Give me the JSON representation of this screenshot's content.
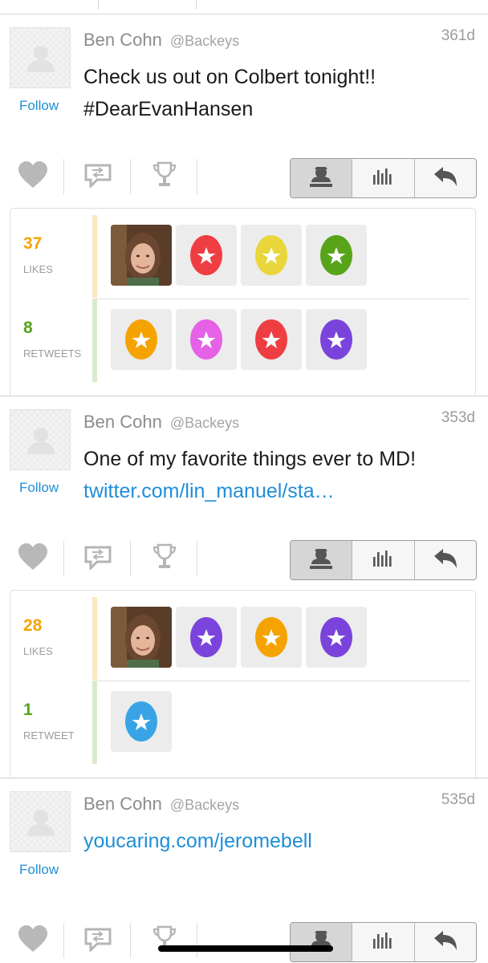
{
  "tweets": [
    {
      "author": "Ben Cohn",
      "handle": "@Backeys",
      "time": "361d",
      "follow_label": "Follow",
      "lines": [
        "Check us out on Colbert tonight!!",
        "#DearEvanHansen"
      ],
      "link_lines": [],
      "stats": {
        "likes_count": "37",
        "likes_label": "LIKES",
        "retweets_count": "8",
        "retweets_label": "RETWEETS",
        "likers": [
          "photo",
          "red",
          "yellow",
          "green"
        ],
        "retweeters": [
          "orange",
          "pink",
          "red",
          "purple"
        ]
      }
    },
    {
      "author": "Ben Cohn",
      "handle": "@Backeys",
      "time": "353d",
      "follow_label": "Follow",
      "lines": [
        "One of my favorite things ever to MD!",
        "twitter.com/lin_manuel/sta…"
      ],
      "link_lines": [
        1
      ],
      "stats": {
        "likes_count": "28",
        "likes_label": "LIKES",
        "retweets_count": "1",
        "retweets_label": "RETWEET",
        "likers": [
          "photo",
          "purple",
          "orange",
          "purple"
        ],
        "retweeters": [
          "blue"
        ]
      }
    },
    {
      "author": "Ben Cohn",
      "handle": "@Backeys",
      "time": "535d",
      "follow_label": "Follow",
      "lines": [
        "youcaring.com/jeromebell"
      ],
      "link_lines": [
        0
      ]
    }
  ],
  "icons": {
    "like": "heart-icon",
    "retweet": "retweet-icon",
    "trophy": "trophy-icon",
    "profile": "profile-icon",
    "stats": "stats-icon",
    "reply": "reply-icon"
  },
  "colors": {
    "link": "#1f8ed8",
    "likes": "#f5a300",
    "retweets": "#55a51c",
    "likes_bar": "#fbe7c0",
    "retweets_bar": "#d9ebcc",
    "egg_red": "#ef3e42",
    "egg_yellow": "#e8d63a",
    "egg_green": "#57a419",
    "egg_orange": "#f5a300",
    "egg_pink": "#e561e6",
    "egg_purple": "#7a44dc",
    "egg_blue": "#38a4e6"
  }
}
